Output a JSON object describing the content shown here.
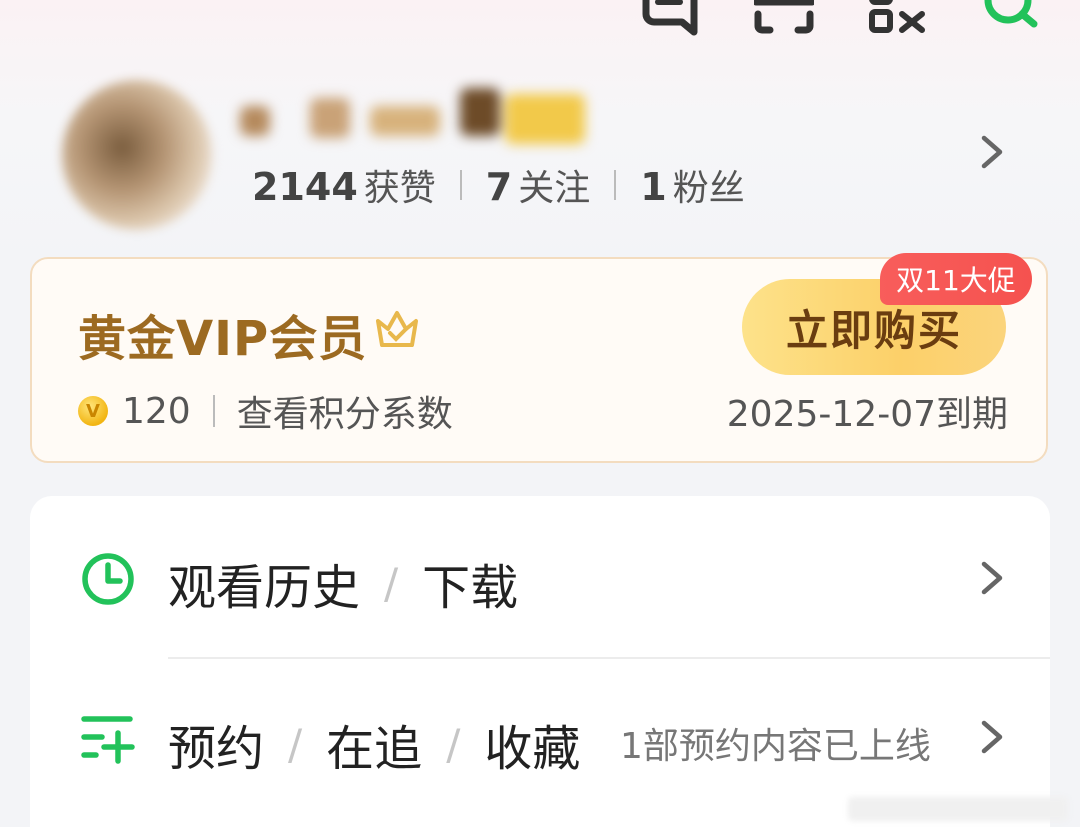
{
  "top_bar": {
    "icons": [
      "message-icon",
      "scan-icon",
      "qr-code-icon",
      "search-icon"
    ]
  },
  "profile": {
    "likes_count": "2144",
    "likes_label": "获赞",
    "following_count": "7",
    "following_label": "关注",
    "followers_count": "1",
    "followers_label": "粉丝"
  },
  "vip": {
    "title": "黄金VIP会员",
    "points": "120",
    "points_link": "查看积分系数",
    "buy_label": "立即购买",
    "promo_badge": "双11大促",
    "expiry": "2025-12-07到期",
    "accent_color": "#9c6a21"
  },
  "menu": {
    "history": {
      "part1": "观看历史",
      "sep": "/",
      "part2": "下载"
    },
    "collection": {
      "part1": "预约",
      "sep1": "/",
      "part2": "在追",
      "sep2": "/",
      "part3": "收藏",
      "hint": "1部预约内容已上线"
    },
    "icon_color": "#22c25a"
  }
}
